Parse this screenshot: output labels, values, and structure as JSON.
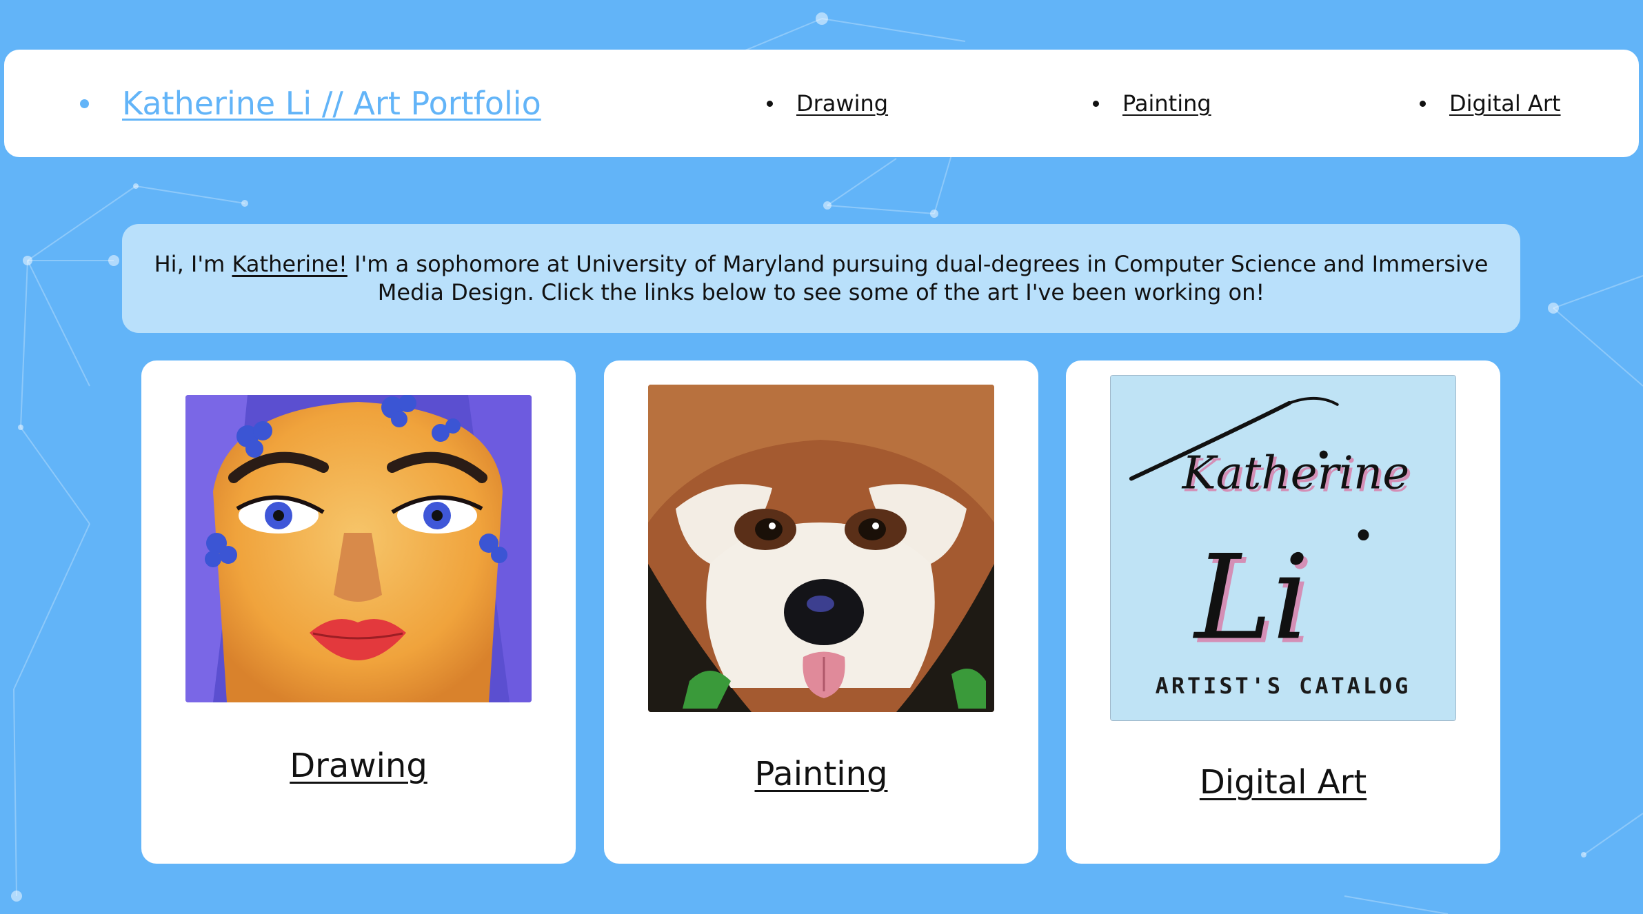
{
  "nav": {
    "brand": "Katherine Li // Art Portfolio",
    "items": [
      {
        "label": "Drawing"
      },
      {
        "label": "Painting"
      },
      {
        "label": "Digital Art"
      }
    ]
  },
  "intro": {
    "greeting": "Hi, I'm ",
    "name": "Katherine!",
    "text": " I'm a sophomore at University of Maryland pursuing dual-degrees in Computer Science and Immersive Media Design. Click the links below to see some of the art I've been working on!"
  },
  "cards": [
    {
      "title": "Drawing"
    },
    {
      "title": "Painting"
    },
    {
      "title": "Digital Art",
      "logo_line1": "Katherine",
      "logo_line2": "Li",
      "logo_caption": "ARTIST'S CATALOG"
    }
  ],
  "colors": {
    "background": "#62b4f8",
    "brand": "#62b4f8",
    "intro_panel": "#b9e0fb",
    "card": "#ffffff"
  }
}
